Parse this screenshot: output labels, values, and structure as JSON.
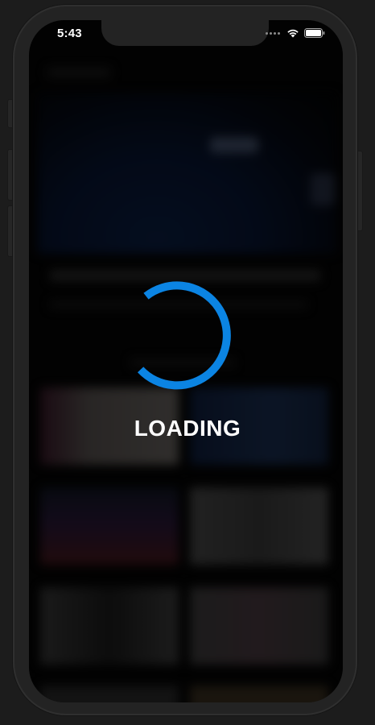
{
  "status_bar": {
    "time": "5:43"
  },
  "loader": {
    "label": "LOADING",
    "color": "#0b84e3"
  },
  "icons": {
    "wifi": "wifi-icon",
    "battery": "battery-icon",
    "cellular": "cellular-dots-icon"
  }
}
